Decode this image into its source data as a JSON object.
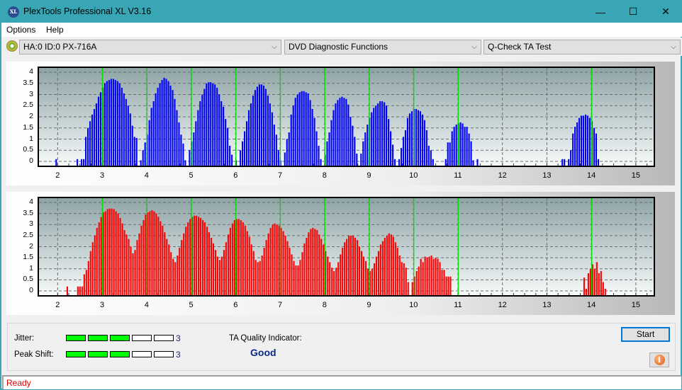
{
  "window": {
    "title": "PlexTools Professional XL V3.16",
    "app_icon": "XL",
    "controls": {
      "minimize": "—",
      "maximize": "☐",
      "close": "✕"
    }
  },
  "menu": {
    "items": [
      {
        "label": "Options"
      },
      {
        "label": "Help"
      }
    ]
  },
  "toolbar": {
    "drive_select": "HA:0 ID:0  PX-716A",
    "function_select": "DVD Diagnostic Functions",
    "test_select": "Q-Check TA Test",
    "arrow": "⌵"
  },
  "chart_data": [
    {
      "type": "bar",
      "title": "",
      "name": "TA land (blue)",
      "color": "#0000ff",
      "xlim": [
        1.58,
        15.4
      ],
      "ylim": [
        0,
        4.1
      ],
      "x_ticks": [
        2,
        3,
        4,
        5,
        6,
        7,
        8,
        9,
        10,
        11,
        12,
        13,
        14,
        15
      ],
      "y_ticks": [
        "0",
        "0.5",
        "1",
        "1.5",
        "2",
        "2.5",
        "3",
        "3.5",
        "4"
      ],
      "y_values": [
        0,
        0.5,
        1,
        1.5,
        2,
        2.5,
        3,
        3.5,
        4
      ],
      "reference_lines": [
        3,
        4,
        5,
        6,
        7,
        8,
        9,
        10,
        11,
        14
      ],
      "reference_color": "#00e000",
      "grid": true,
      "bar_start": 1.95,
      "bar_step": 0.0476,
      "values": [
        0.1,
        0,
        0,
        0,
        0,
        0,
        0,
        0,
        0,
        0,
        0.1,
        0,
        0.1,
        0.1,
        1.1,
        1.5,
        1.8,
        2.1,
        2.35,
        2.6,
        2.9,
        3.1,
        3.3,
        3.5,
        3.6,
        3.65,
        3.7,
        3.7,
        3.65,
        3.6,
        3.5,
        3.3,
        3.05,
        2.8,
        2.5,
        2.15,
        1.6,
        1.1,
        1.05,
        0,
        0.05,
        0.5,
        0.85,
        1.2,
        1.85,
        2.4,
        2.7,
        3.05,
        3.3,
        3.5,
        3.65,
        3.75,
        3.7,
        3.6,
        3.4,
        3.2,
        2.8,
        2.3,
        1.75,
        1.2,
        0.8,
        0.05,
        0,
        0.5,
        0.9,
        1.3,
        1.8,
        2.3,
        2.7,
        3.0,
        3.25,
        3.5,
        3.55,
        3.55,
        3.5,
        3.45,
        3.3,
        3.0,
        2.7,
        2.45,
        1.9,
        1.5,
        0.7,
        0.3,
        0,
        0.05,
        0,
        0.5,
        0.9,
        1.35,
        1.8,
        2.3,
        2.6,
        2.95,
        3.2,
        3.35,
        3.45,
        3.45,
        3.4,
        3.25,
        2.95,
        2.6,
        2.2,
        1.65,
        1.2,
        0.5,
        0.05,
        0,
        0.4,
        1.0,
        1.3,
        2.1,
        2.5,
        2.85,
        3.0,
        3.1,
        3.15,
        3.15,
        3.1,
        3.05,
        2.75,
        2.35,
        1.95,
        1.35,
        0.7,
        0.1,
        0,
        0.3,
        0.9,
        1.3,
        1.85,
        2.3,
        2.6,
        2.75,
        2.85,
        2.9,
        2.85,
        2.8,
        2.55,
        2.0,
        1.6,
        1.1,
        0.35,
        0,
        0.35,
        0.9,
        1.3,
        1.65,
        1.95,
        2.2,
        2.4,
        2.5,
        2.6,
        2.7,
        2.7,
        2.65,
        2.5,
        1.9,
        1.35,
        0.75,
        0.1,
        0,
        0.1,
        0.6,
        1.1,
        1.4,
        1.95,
        2.15,
        2.25,
        2.35,
        2.35,
        2.3,
        2.25,
        2.1,
        1.85,
        1.4,
        0.7,
        0.5,
        0.1,
        0,
        0,
        0,
        0,
        0,
        0.1,
        0.85,
        0.85,
        1.35,
        1.55,
        1.65,
        1.7,
        1.75,
        1.7,
        1.55,
        1.55,
        1.25,
        0.9,
        0.05,
        0,
        0.1
      ],
      "segments": [
        {
          "start": 13.33,
          "values": [
            0.1,
            0.1,
            0,
            0.1,
            0.5,
            1.25,
            1.55,
            1.75,
            1.95,
            2.05,
            2.05,
            2.1,
            2.05,
            1.95,
            1.8,
            1.5,
            1.25,
            0.1
          ]
        }
      ]
    },
    {
      "type": "bar",
      "title": "",
      "name": "TA groove (red)",
      "color": "#ff0000",
      "xlim": [
        1.58,
        15.4
      ],
      "ylim": [
        0,
        4.1
      ],
      "x_ticks": [
        2,
        3,
        4,
        5,
        6,
        7,
        8,
        9,
        10,
        11,
        12,
        13,
        14,
        15
      ],
      "y_ticks": [
        "0",
        "0.5",
        "1",
        "1.5",
        "2",
        "2.5",
        "3",
        "3.5",
        "4"
      ],
      "y_values": [
        0,
        0.5,
        1,
        1.5,
        2,
        2.5,
        3,
        3.5,
        4
      ],
      "reference_lines": [
        3,
        4,
        5,
        6,
        7,
        8,
        9,
        10,
        11,
        14
      ],
      "reference_color": "#00e000",
      "grid": true,
      "bar_start": 2.2,
      "bar_step": 0.0476,
      "values": [
        0.2,
        0,
        0,
        0,
        0,
        0.2,
        0.2,
        0.2,
        0.75,
        0.95,
        1.35,
        1.8,
        2.2,
        2.5,
        2.85,
        3.1,
        3.35,
        3.55,
        3.6,
        3.7,
        3.72,
        3.72,
        3.7,
        3.6,
        3.5,
        3.3,
        3.05,
        2.75,
        2.55,
        2.35,
        2.0,
        1.7,
        1.85,
        2.3,
        2.6,
        2.95,
        3.2,
        3.45,
        3.55,
        3.6,
        3.65,
        3.6,
        3.5,
        3.35,
        3.15,
        2.95,
        2.65,
        2.35,
        2.1,
        1.75,
        1.45,
        1.3,
        1.6,
        1.95,
        2.3,
        2.6,
        2.9,
        3.1,
        3.25,
        3.35,
        3.4,
        3.4,
        3.35,
        3.3,
        3.2,
        3.1,
        2.9,
        2.65,
        2.4,
        2.15,
        1.85,
        1.55,
        1.4,
        1.55,
        1.85,
        2.2,
        2.55,
        2.85,
        3.05,
        3.2,
        3.25,
        3.25,
        3.2,
        3.1,
        2.95,
        2.7,
        2.45,
        2.1,
        1.8,
        1.4,
        1.3,
        1.35,
        1.6,
        1.95,
        2.3,
        2.6,
        2.85,
        3.0,
        3.05,
        3.0,
        2.95,
        2.85,
        2.7,
        2.5,
        2.25,
        1.95,
        1.65,
        1.35,
        1.15,
        1.15,
        1.4,
        1.75,
        2.15,
        2.4,
        2.65,
        2.8,
        2.85,
        2.8,
        2.75,
        2.55,
        2.35,
        2.1,
        1.8,
        1.55,
        1.3,
        1.05,
        0.9,
        1.05,
        1.3,
        1.65,
        1.95,
        2.2,
        2.35,
        2.5,
        2.5,
        2.5,
        2.4,
        2.3,
        2.0,
        1.8,
        1.55,
        1.35,
        1.0,
        0.9,
        1.0,
        1.25,
        1.55,
        1.8,
        2.1,
        2.25,
        2.4,
        2.5,
        2.6,
        2.55,
        2.45,
        2.2,
        1.95,
        1.6,
        1.3,
        1.25,
        1.05,
        0.4,
        0,
        0.4,
        0.65,
        0.9,
        1.1,
        1.45,
        1.3,
        1.55,
        1.5,
        1.55,
        1.6,
        1.45,
        1.5,
        1.45,
        1.3,
        0.95,
        0.95,
        0.65,
        0.65,
        0.65
      ],
      "segments": [
        {
          "start": 13.82,
          "values": [
            0.6,
            0.1,
            0.8,
            1.0,
            1.2,
            1.0,
            1.3,
            0.8,
            0.9,
            0.4,
            0.1
          ]
        }
      ]
    }
  ],
  "results": {
    "jitter_label": "Jitter:",
    "jitter_level": 3,
    "jitter_max": 5,
    "jitter_value": "3",
    "peak_shift_label": "Peak Shift:",
    "peak_shift_level": 3,
    "peak_shift_max": 5,
    "peak_shift_value": "3",
    "quality_label": "TA Quality Indicator:",
    "quality_value": "Good"
  },
  "buttons": {
    "start": "Start",
    "info": "i"
  },
  "status": {
    "text": "Ready"
  }
}
